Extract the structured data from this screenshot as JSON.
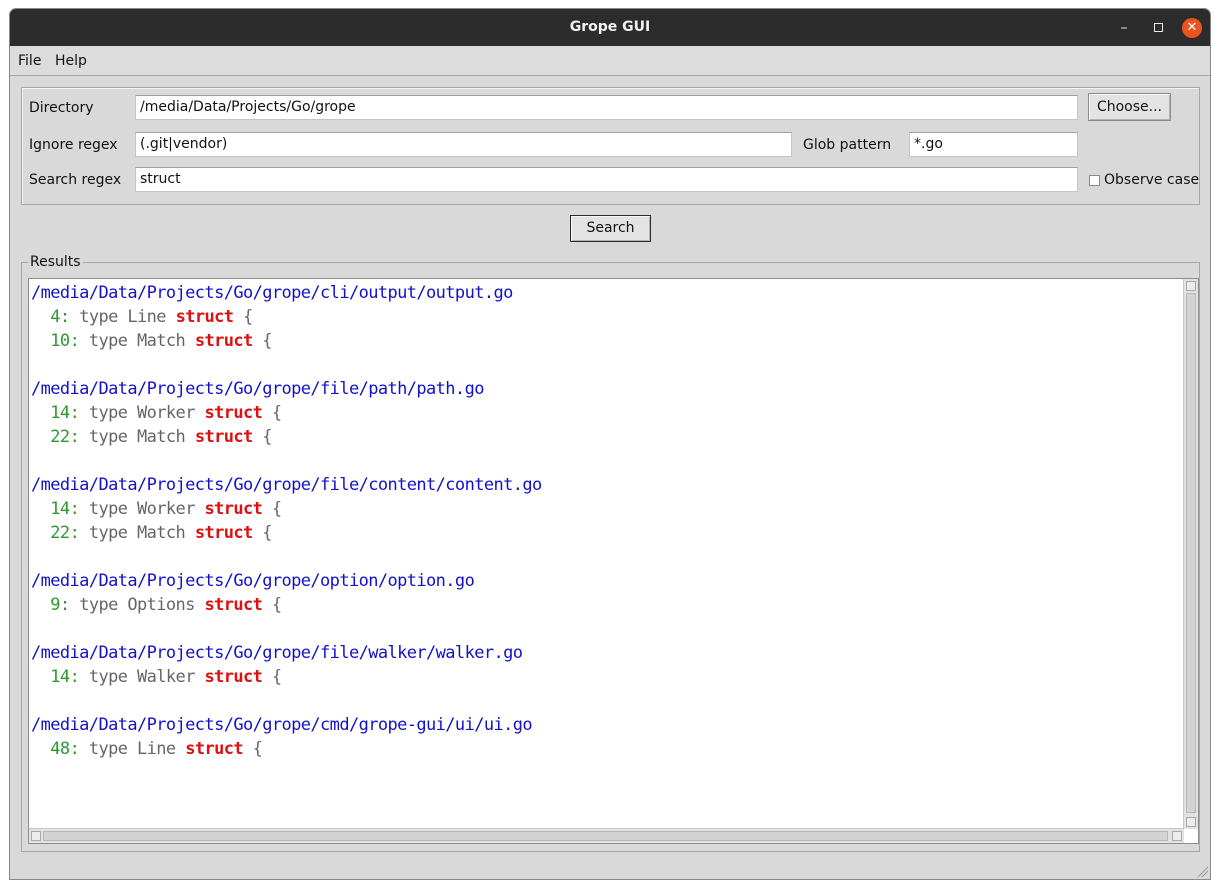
{
  "window": {
    "title": "Grope GUI"
  },
  "menubar": {
    "file": "File",
    "help": "Help"
  },
  "form": {
    "directory_label": "Directory",
    "directory_value": "/media/Data/Projects/Go/grope",
    "choose_label": "Choose...",
    "ignore_label": "Ignore regex",
    "ignore_value": "(.git|vendor)",
    "glob_label": "Glob pattern",
    "glob_value": "*.go",
    "search_label": "Search regex",
    "search_value": "struct",
    "observe_case_label": "Observe case",
    "observe_case_checked": false
  },
  "search_button": "Search",
  "results": {
    "label": "Results",
    "files": [
      {
        "path": "/media/Data/Projects/Go/grope/cli/output/output.go",
        "matches": [
          {
            "line": "4",
            "prefix": "type Line ",
            "match": "struct",
            "suffix": " {"
          },
          {
            "line": "10",
            "prefix": "type Match ",
            "match": "struct",
            "suffix": " {"
          }
        ]
      },
      {
        "path": "/media/Data/Projects/Go/grope/file/path/path.go",
        "matches": [
          {
            "line": "14",
            "prefix": "type Worker ",
            "match": "struct",
            "suffix": " {"
          },
          {
            "line": "22",
            "prefix": "type Match ",
            "match": "struct",
            "suffix": " {"
          }
        ]
      },
      {
        "path": "/media/Data/Projects/Go/grope/file/content/content.go",
        "matches": [
          {
            "line": "14",
            "prefix": "type Worker ",
            "match": "struct",
            "suffix": " {"
          },
          {
            "line": "22",
            "prefix": "type Match ",
            "match": "struct",
            "suffix": " {"
          }
        ]
      },
      {
        "path": "/media/Data/Projects/Go/grope/option/option.go",
        "matches": [
          {
            "line": "9",
            "prefix": "type Options ",
            "match": "struct",
            "suffix": " {"
          }
        ]
      },
      {
        "path": "/media/Data/Projects/Go/grope/file/walker/walker.go",
        "matches": [
          {
            "line": "14",
            "prefix": "type Walker ",
            "match": "struct",
            "suffix": " {"
          }
        ]
      },
      {
        "path": "/media/Data/Projects/Go/grope/cmd/grope-gui/ui/ui.go",
        "matches": [
          {
            "line": "48",
            "prefix": "type Line ",
            "match": "struct",
            "suffix": " {"
          }
        ]
      }
    ]
  },
  "colors": {
    "file_path": "#1111cc",
    "line_number": "#2e9a2e",
    "line_text": "#666666",
    "match": "#e01010",
    "close_button": "#e95420"
  },
  "icons": {
    "minimize": "minimize-icon",
    "maximize": "maximize-icon",
    "close": "close-icon",
    "resize_grip": "resize-grip-icon"
  }
}
